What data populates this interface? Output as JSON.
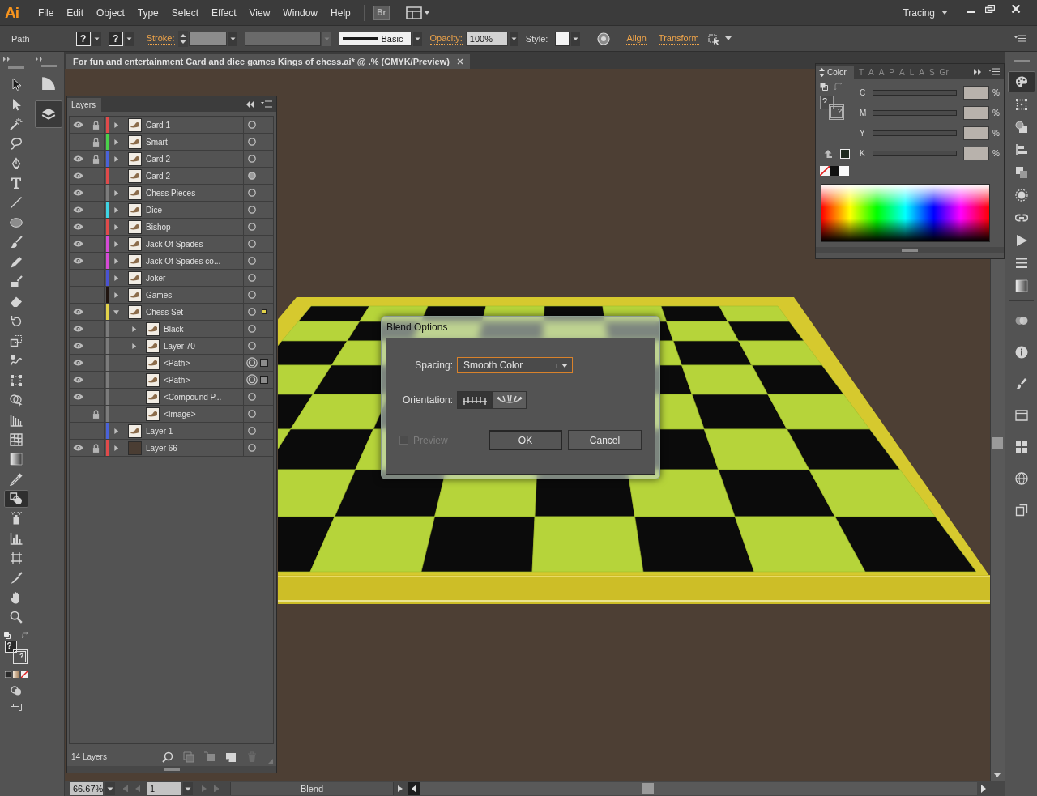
{
  "app": {
    "logo": "Ai",
    "menus": [
      "File",
      "Edit",
      "Object",
      "Type",
      "Select",
      "Effect",
      "View",
      "Window",
      "Help"
    ],
    "bridge": "Br",
    "workspace": "Tracing"
  },
  "control_bar": {
    "selection": "Path",
    "fill_mark": "?",
    "stroke_mark": "?",
    "stroke_link": "Stroke:",
    "profile": "Basic",
    "opacity_link": "Opacity:",
    "opacity": "100%",
    "style_label": "Style:",
    "align_link": "Align",
    "transform_link": "Transform"
  },
  "toolbar": {
    "tools": [
      {
        "selected": false
      },
      {
        "selected": false
      },
      {
        "selected": false
      },
      {
        "selected": false
      },
      {
        "selected": false
      },
      {
        "selected": false
      },
      {
        "selected": false
      },
      {
        "selected": false
      },
      {
        "selected": false
      },
      {
        "selected": false
      },
      {
        "selected": false
      },
      {
        "selected": false
      },
      {
        "selected": false
      },
      {
        "selected": false
      },
      {
        "selected": false
      },
      {
        "selected": false
      },
      {
        "selected": false
      },
      {
        "selected": false
      },
      {
        "selected": false
      },
      {
        "selected": false
      },
      {
        "selected": false
      },
      {
        "selected": true
      },
      {
        "selected": false
      },
      {
        "selected": false
      },
      {
        "selected": false
      },
      {
        "selected": false
      },
      {
        "selected": false
      },
      {
        "selected": false
      }
    ],
    "fill_mark": "?",
    "stroke_mark": "?"
  },
  "side_dock": {
    "buttons": [
      {
        "selected": false
      },
      {
        "selected": true
      }
    ]
  },
  "document_tab": {
    "title": "For fun and entertainment Card and dice games Kings of chess.ai* @ .% (CMYK/Preview)"
  },
  "layers_panel": {
    "title": "Layers",
    "layers": [
      {
        "name": "Card 1",
        "kind": "art",
        "visible": true,
        "locked": true,
        "color": "#e04a4a",
        "expanded": false,
        "selected": false,
        "targeted": false,
        "appearance": false
      },
      {
        "name": "Smart",
        "kind": "art",
        "visible": false,
        "locked": true,
        "color": "#4ad04a",
        "expanded": false,
        "selected": false,
        "targeted": false,
        "appearance": false
      },
      {
        "name": "Card 2",
        "kind": "art",
        "visible": true,
        "locked": true,
        "color": "#4a62d8",
        "expanded": false,
        "selected": false,
        "targeted": false,
        "appearance": false
      },
      {
        "name": "Card 2",
        "kind": "art",
        "visible": true,
        "locked": false,
        "color": "#e04a4a",
        "selected": false,
        "targeted": false,
        "appearance": true
      },
      {
        "name": "Chess Pieces",
        "kind": "art",
        "visible": true,
        "locked": false,
        "color": "#7c7c7c",
        "expanded": false,
        "selected": false,
        "targeted": false,
        "appearance": false
      },
      {
        "name": "Dice",
        "kind": "art",
        "visible": true,
        "locked": false,
        "color": "#3fd4e4",
        "expanded": false,
        "selected": false,
        "targeted": false,
        "appearance": false
      },
      {
        "name": "Bishop",
        "kind": "art",
        "visible": true,
        "locked": false,
        "color": "#e04a4a",
        "expanded": false,
        "selected": false,
        "targeted": false,
        "appearance": false
      },
      {
        "name": "Jack Of Spades",
        "kind": "art",
        "visible": true,
        "locked": false,
        "color": "#d64ad6",
        "expanded": false,
        "selected": false,
        "targeted": false,
        "appearance": false
      },
      {
        "name": "Jack Of Spades co...",
        "kind": "art",
        "visible": true,
        "locked": false,
        "color": "#d64ad6",
        "expanded": false,
        "selected": false,
        "targeted": false,
        "appearance": false
      },
      {
        "name": "Joker",
        "kind": "art",
        "visible": false,
        "locked": false,
        "color": "#4a52d2",
        "expanded": false,
        "selected": false,
        "targeted": false,
        "appearance": false
      },
      {
        "name": "Games",
        "kind": "art",
        "visible": false,
        "locked": false,
        "color": "#201510",
        "expanded": false,
        "selected": false,
        "targeted": false,
        "appearance": false
      },
      {
        "name": "Chess Set",
        "kind": "art",
        "visible": true,
        "locked": false,
        "color": "#e2d24a",
        "expanded": true,
        "selected": true,
        "targeted": false,
        "appearance": false,
        "children": [
          {
            "name": "Black",
            "kind": "art",
            "visible": true,
            "locked": false,
            "color": "#7c7c7c",
            "expanded": false,
            "selected": false,
            "targeted": false,
            "appearance": false
          },
          {
            "name": "Layer 70",
            "kind": "art",
            "visible": true,
            "locked": false,
            "color": "#7c7c7c",
            "expanded": false,
            "selected": false,
            "targeted": false,
            "appearance": false
          },
          {
            "name": "<Path>",
            "kind": "art",
            "visible": true,
            "locked": false,
            "color": "#7c7c7c",
            "selected": true,
            "targeted": true,
            "appearance": false
          },
          {
            "name": "<Path>",
            "kind": "art",
            "visible": true,
            "locked": false,
            "color": "#7c7c7c",
            "selected": true,
            "targeted": true,
            "appearance": false
          },
          {
            "name": "<Compound P...",
            "kind": "art",
            "visible": true,
            "locked": false,
            "color": "#7c7c7c",
            "selected": false,
            "targeted": false,
            "appearance": false
          },
          {
            "name": "<Image>",
            "kind": "art",
            "visible": false,
            "locked": true,
            "color": "#7c7c7c",
            "selected": false,
            "targeted": false,
            "appearance": false
          }
        ]
      },
      {
        "name": "Layer 1",
        "kind": "art",
        "visible": false,
        "locked": false,
        "color": "#4a62d8",
        "expanded": false,
        "selected": false,
        "targeted": false,
        "appearance": false
      },
      {
        "name": "Layer 66",
        "kind": "dark",
        "visible": true,
        "locked": true,
        "color": "#e04a4a",
        "expanded": false,
        "selected": false,
        "targeted": false,
        "appearance": false
      }
    ],
    "count": "14 Layers"
  },
  "color_panel": {
    "tabs": [
      {
        "label": "Color",
        "selected": true
      },
      {
        "label": "T",
        "selected": false
      },
      {
        "label": "A",
        "selected": false
      },
      {
        "label": "A",
        "selected": false
      },
      {
        "label": "P",
        "selected": false
      },
      {
        "label": "A",
        "selected": false
      },
      {
        "label": "L",
        "selected": false
      },
      {
        "label": "A",
        "selected": false
      },
      {
        "label": "S",
        "selected": false
      },
      {
        "label": "Gr",
        "selected": false
      }
    ],
    "fill_mark": "?",
    "stroke_mark": "?",
    "channels": [
      {
        "label": "C",
        "unit": "%"
      },
      {
        "label": "M",
        "unit": "%"
      },
      {
        "label": "Y",
        "unit": "%"
      },
      {
        "label": "K",
        "unit": "%"
      }
    ]
  },
  "right_dock": {
    "buttons": [
      {
        "selected": true
      },
      {
        "selected": false
      },
      {
        "selected": false
      },
      {
        "selected": false
      },
      {
        "selected": false
      },
      {
        "selected": false
      },
      {
        "selected": false
      },
      {
        "selected": false
      },
      {
        "selected": false
      },
      {
        "selected": false
      },
      {
        "selected": false
      },
      {
        "selected": false
      },
      {
        "selected": false
      },
      {
        "selected": false
      },
      {
        "selected": false
      },
      {
        "selected": false
      },
      {
        "selected": false
      }
    ]
  },
  "blend_dialog": {
    "title": "Blend Options",
    "spacing_label": "Spacing:",
    "spacing": "Smooth Color",
    "orientation_label": "Orientation:",
    "orientations": [
      {
        "selected": true
      },
      {
        "selected": false
      }
    ],
    "preview": {
      "label": "Preview",
      "checked": false,
      "disabled": true
    },
    "buttons": [
      {
        "label": "OK",
        "kind": "default"
      },
      {
        "label": "Cancel",
        "kind": "normal"
      }
    ]
  },
  "status_bar": {
    "zoom": "66.67%",
    "page": "1",
    "status": "Blend"
  }
}
